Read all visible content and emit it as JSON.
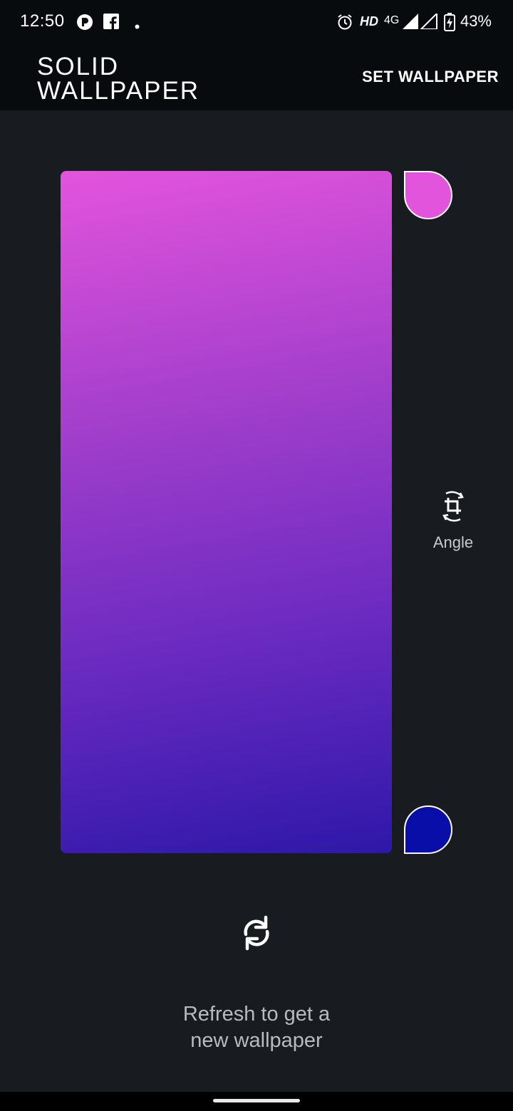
{
  "status_bar": {
    "time": "12:50",
    "network_label": "HD",
    "network_type": "4G",
    "battery_percent": "43%",
    "icons": [
      "app-notification-icon",
      "facebook-icon",
      "dot-icon",
      "alarm-icon",
      "signal-icon",
      "battery-charging-icon"
    ]
  },
  "app_bar": {
    "logo_line1": "SOLID",
    "logo_line2": "WALLPAPER",
    "set_wallpaper_label": "SET WALLPAPER"
  },
  "wallpaper": {
    "color_top": "#e354dc",
    "color_bottom": "#0a0ea8",
    "angle_label": "Angle"
  },
  "refresh": {
    "hint_line1": "Refresh to get a",
    "hint_line2": "new wallpaper"
  },
  "colors": {
    "background": "#181c20",
    "bar_background": "#080b0e"
  }
}
